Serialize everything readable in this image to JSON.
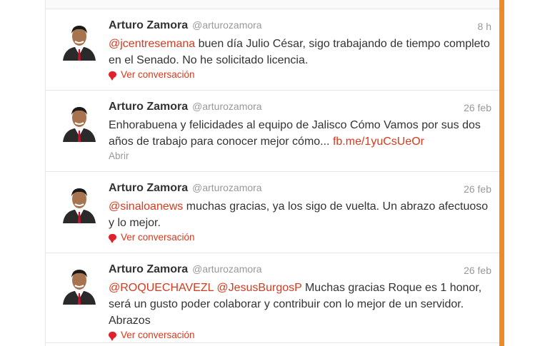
{
  "tweets": [
    {
      "name": "Arturo Zamora",
      "handle": "@arturozamora",
      "time": "8 h",
      "mention": "@jcentresemana",
      "text": " buen día Julio César, sigo trabajando de tiempo completo en el Senado. No he solicitado licencia.",
      "action": "Ver conversación"
    },
    {
      "name": "Arturo Zamora",
      "handle": "@arturozamora",
      "time": "26 feb",
      "text": "Enhorabuena y felicidades al equipo de Jalisco Cómo Vamos por sus dos años de trabajo para conocer mejor cómo... ",
      "link": "fb.me/1yuCsUeOr",
      "action": "Abrir"
    },
    {
      "name": "Arturo Zamora",
      "handle": "@arturozamora",
      "time": "26 feb",
      "mention": "@sinaloanews",
      "text": " muchas gracias, ya los sigo de vuelta. Un abrazo afectuoso y lo mejor.",
      "action": "Ver conversación"
    },
    {
      "name": "Arturo Zamora",
      "handle": "@arturozamora",
      "time": "26 feb",
      "mention": "@ROQUECHAVEZL",
      "mention2": "@JesusBurgosP",
      "text": " Muchas gracias Roque es 1 honor, será un gusto poder colaborar y contribuir con lo mejor de un servidor. Abrazos",
      "action": "Ver conversación"
    }
  ],
  "colors": {
    "accent": "#d63a1f",
    "name": "#333333",
    "muted": "#999999",
    "bar": "#f08a24"
  },
  "icons": {
    "reply": "speech-bubble-icon"
  }
}
